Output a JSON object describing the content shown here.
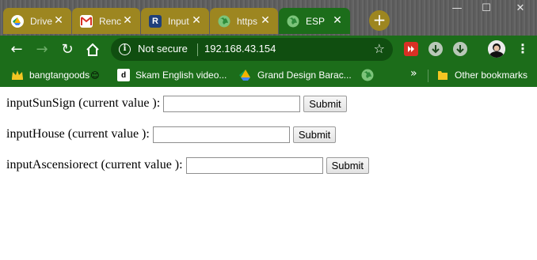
{
  "browser": {
    "tabs": [
      {
        "title": "Drive",
        "icon": "google-drive-icon"
      },
      {
        "title": "Renc",
        "icon": "gmail-icon"
      },
      {
        "title": "Input",
        "icon": "r-icon"
      },
      {
        "title": "https",
        "icon": "globe-icon"
      },
      {
        "title": "ESP",
        "icon": "globe-icon",
        "active": true
      }
    ],
    "new_tab_symbol": "+",
    "close_symbol": "✕",
    "address": {
      "security_label": "Not secure",
      "url": "192.168.43.154"
    },
    "bookmarks": [
      {
        "label": "bangtangoods",
        "icon": "crown-icon",
        "emoji": "😊"
      },
      {
        "label": "Skam English video...",
        "icon": "dailymotion-icon"
      },
      {
        "label": "Grand Design Barac...",
        "icon": "google-drive-icon"
      },
      {
        "label": "",
        "icon": "globe-icon"
      }
    ],
    "overflow_symbol": "»",
    "other_bookmarks": "Other bookmarks",
    "colors": {
      "theme_green": "#1c6d1a",
      "tab_gold": "#9d8620"
    }
  },
  "page": {
    "form_rows": [
      {
        "label": "inputSunSign (current value ):",
        "value": "",
        "button": "Submit"
      },
      {
        "label": "inputHouse (current value ):",
        "value": "",
        "button": "Submit"
      },
      {
        "label": "inputAscensiorect (current value ):",
        "value": "",
        "button": "Submit"
      }
    ]
  }
}
